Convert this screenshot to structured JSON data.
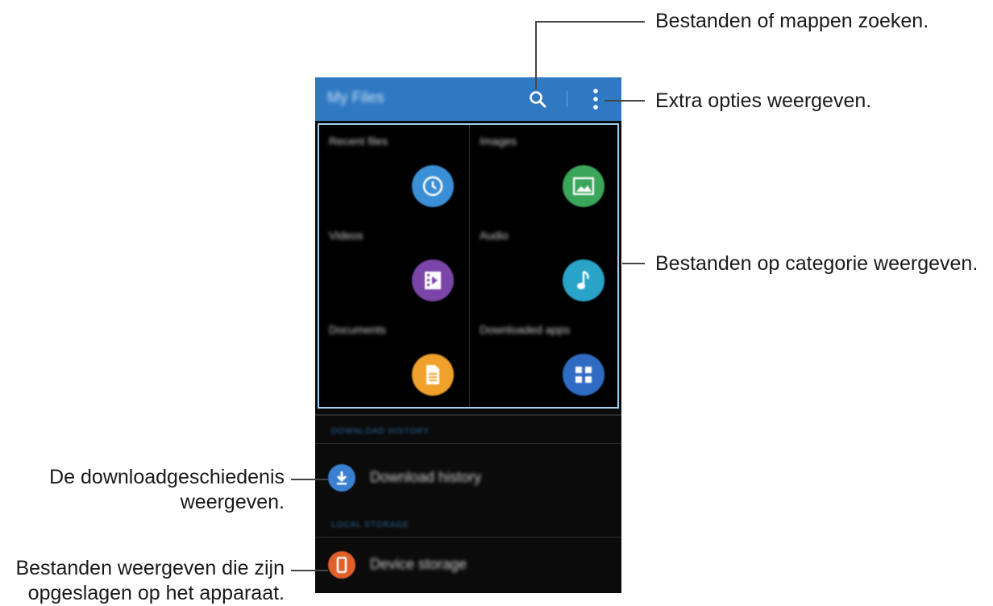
{
  "app": {
    "title": "My Files",
    "toolbar": {
      "search_icon": "search-icon",
      "more_icon": "more-options-icon"
    }
  },
  "categories": [
    {
      "label": "Recent files",
      "icon": "clock-icon",
      "color": "#3a8fd6"
    },
    {
      "label": "Images",
      "icon": "image-icon",
      "color": "#3aa65a"
    },
    {
      "label": "Videos",
      "icon": "video-icon",
      "color": "#7b44a8"
    },
    {
      "label": "Audio",
      "icon": "music-note-icon",
      "color": "#2aa3c9"
    },
    {
      "label": "Documents",
      "icon": "document-icon",
      "color": "#f0a12b"
    },
    {
      "label": "Downloaded apps",
      "icon": "apps-grid-icon",
      "color": "#2f6bc2"
    }
  ],
  "download_section": {
    "header": "DOWNLOAD HISTORY",
    "item_label": "Download history",
    "icon": "download-icon",
    "color": "#3a7fd0"
  },
  "storage_section": {
    "header": "LOCAL STORAGE",
    "item_label": "Device storage",
    "icon": "phone-icon",
    "color": "#e0602c"
  },
  "callouts": {
    "search": "Bestanden of mappen zoeken.",
    "more": "Extra opties weergeven.",
    "categories": "Bestanden op categorie weergeven.",
    "download_line1": "De downloadgeschiedenis",
    "download_line2": "weergeven.",
    "storage_line1": "Bestanden weergeven die zijn",
    "storage_line2": "opgeslagen op het apparaat."
  },
  "colors": {
    "appbar": "#2f78c2",
    "highlight_border": "#9ecdf0",
    "background": "#000000"
  }
}
